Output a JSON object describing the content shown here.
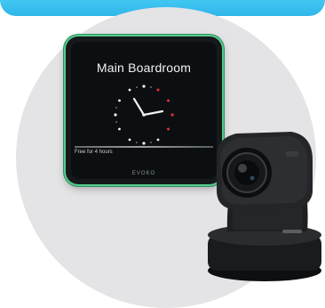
{
  "room": {
    "title": "Main Boardroom",
    "status": "Free for 4 hours",
    "brand": "EVOKO"
  },
  "colors": {
    "banner": "#2fb6e8",
    "accent_green": "#58c98d",
    "busy_red": "#e0303a",
    "free_white": "#f2f2f2"
  },
  "icons": [
    "clock-icon",
    "ptz-camera-icon"
  ]
}
